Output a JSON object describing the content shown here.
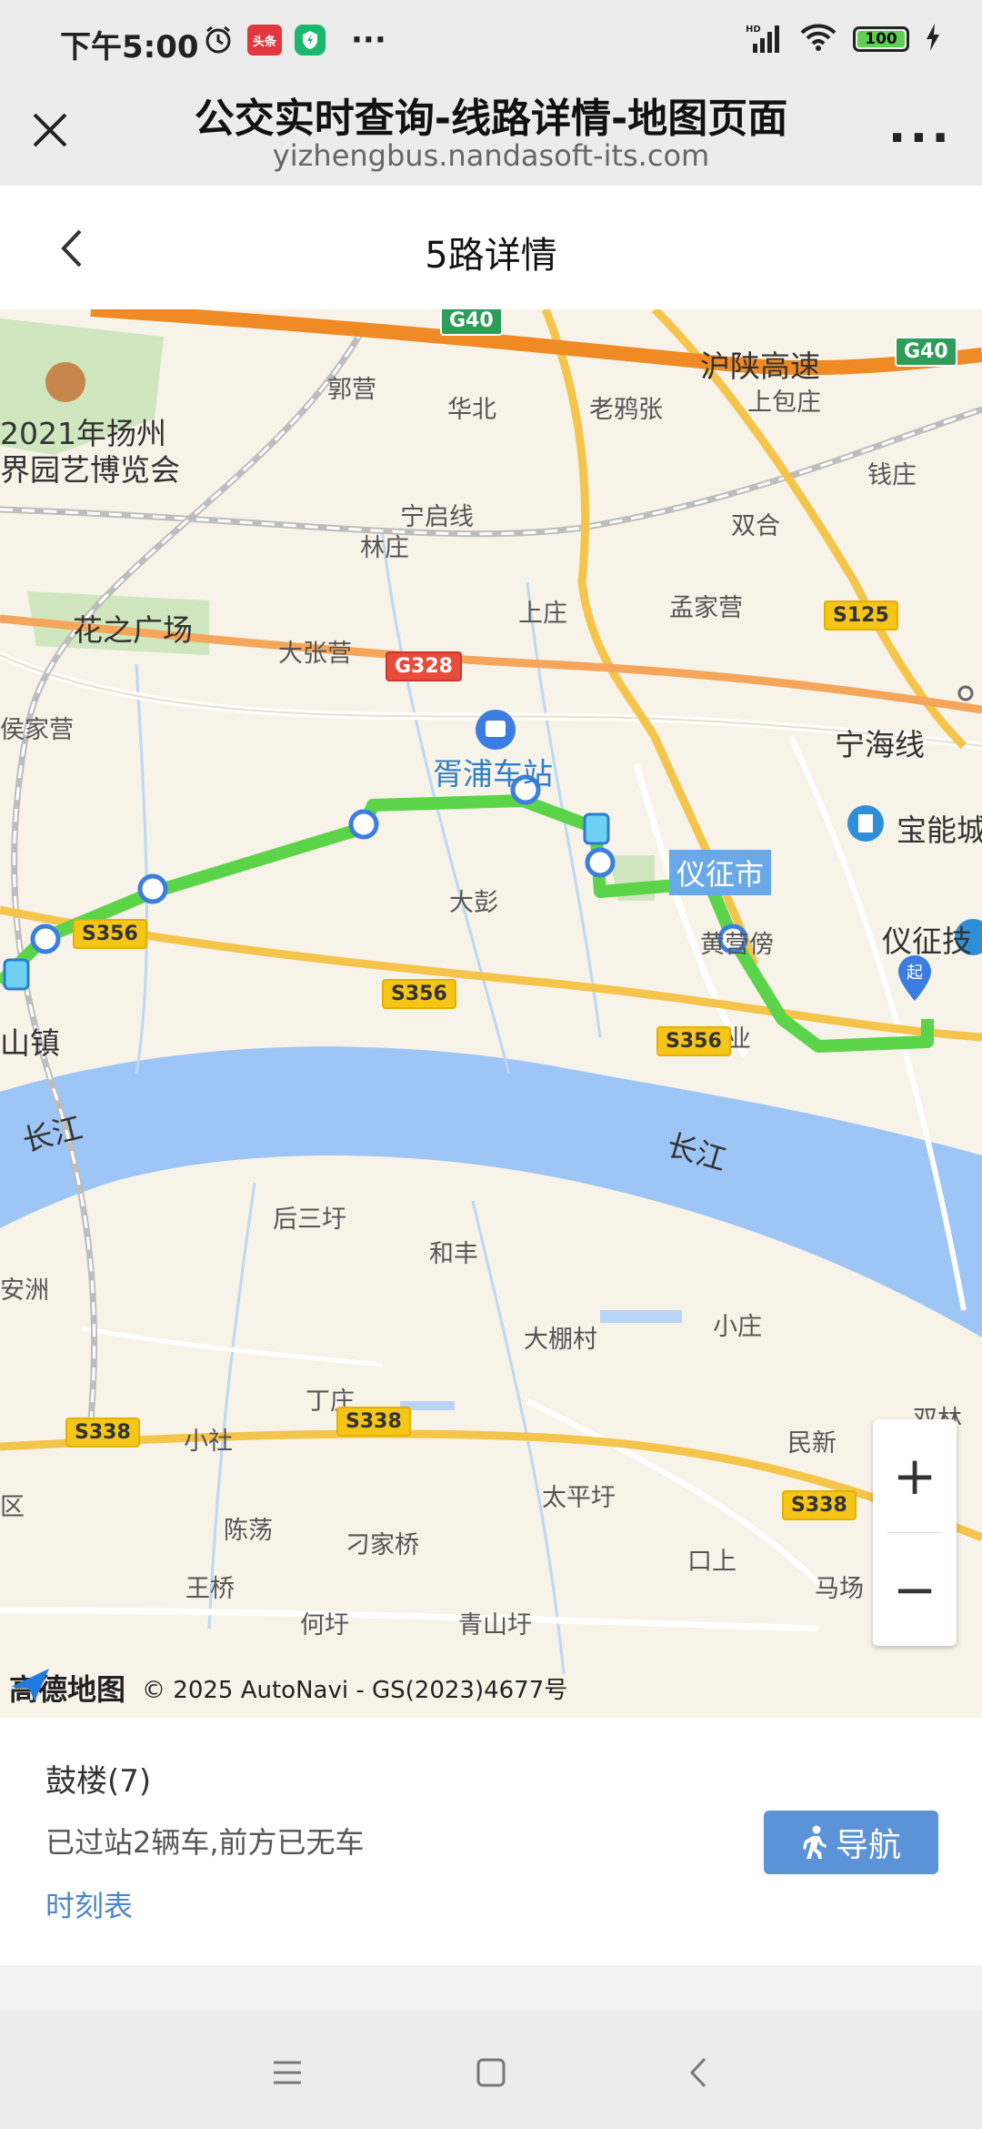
{
  "status_bar": {
    "time": "下午5:00",
    "news_badge": "头条",
    "battery": "100"
  },
  "browser": {
    "title": "公交实时查询-线路详情-地图页面",
    "url": "yizhengbus.nandasoft-its.com"
  },
  "page": {
    "title": "5路详情"
  },
  "map": {
    "place_labels": [
      {
        "text": "郭营",
        "cls": ""
      },
      {
        "text": "华北",
        "cls": ""
      },
      {
        "text": "老鸦张",
        "cls": ""
      },
      {
        "text": "上包庄",
        "cls": ""
      },
      {
        "text": "钱庄",
        "cls": ""
      },
      {
        "text": "2021年扬州",
        "cls": "big"
      },
      {
        "text": "界园艺博览会",
        "cls": "big"
      },
      {
        "text": "宁启线",
        "cls": ""
      },
      {
        "text": "林庄",
        "cls": ""
      },
      {
        "text": "双合",
        "cls": ""
      },
      {
        "text": "花之广场",
        "cls": "big"
      },
      {
        "text": "上庄",
        "cls": ""
      },
      {
        "text": "孟家营",
        "cls": ""
      },
      {
        "text": "大张营",
        "cls": ""
      },
      {
        "text": "侯家营",
        "cls": ""
      },
      {
        "text": "宁海线",
        "cls": "big"
      },
      {
        "text": "胥浦车站",
        "cls": "big blue"
      },
      {
        "text": "宝能城",
        "cls": "big"
      },
      {
        "text": "大彭",
        "cls": ""
      },
      {
        "text": "黄营傍",
        "cls": ""
      },
      {
        "text": "仪征技",
        "cls": "big"
      },
      {
        "text": "山镇",
        "cls": "big"
      },
      {
        "text": "林业",
        "cls": ""
      },
      {
        "text": "长江",
        "cls": "big"
      },
      {
        "text": "长江",
        "cls": "big"
      },
      {
        "text": "后三圩",
        "cls": ""
      },
      {
        "text": "和丰",
        "cls": ""
      },
      {
        "text": "安洲",
        "cls": ""
      },
      {
        "text": "大棚村",
        "cls": ""
      },
      {
        "text": "小庄",
        "cls": ""
      },
      {
        "text": "丁庄",
        "cls": ""
      },
      {
        "text": "双林",
        "cls": ""
      },
      {
        "text": "小社",
        "cls": ""
      },
      {
        "text": "民新",
        "cls": ""
      },
      {
        "text": "太平圩",
        "cls": ""
      },
      {
        "text": "区",
        "cls": ""
      },
      {
        "text": "陈荡",
        "cls": ""
      },
      {
        "text": "刁家桥",
        "cls": ""
      },
      {
        "text": "口上",
        "cls": ""
      },
      {
        "text": "王桥",
        "cls": ""
      },
      {
        "text": "马场",
        "cls": ""
      },
      {
        "text": "何圩",
        "cls": ""
      },
      {
        "text": "青山圩",
        "cls": ""
      },
      {
        "text": "沪陕高速",
        "cls": "big"
      }
    ],
    "road_badges": [
      {
        "text": "G40",
        "cls": "green"
      },
      {
        "text": "G40",
        "cls": "green"
      },
      {
        "text": "G328",
        "cls": "red"
      },
      {
        "text": "S125",
        "cls": "yellow"
      },
      {
        "text": "S356",
        "cls": "yellow"
      },
      {
        "text": "S356",
        "cls": "yellow"
      },
      {
        "text": "S356",
        "cls": "yellow"
      },
      {
        "text": "S338",
        "cls": "yellow"
      },
      {
        "text": "S338",
        "cls": "yellow"
      },
      {
        "text": "S338",
        "cls": "yellow"
      }
    ],
    "city_tag": "仪征市",
    "start_marker": "起",
    "zoom_in": "+",
    "zoom_out": "−",
    "logo_text": "高德地图",
    "copyright": "© 2025 AutoNavi - GS(2023)4677号"
  },
  "info": {
    "station": "鼓楼(7)",
    "status": "已过站2辆车,前方已无车",
    "timetable": "时刻表",
    "navigate": "导航"
  }
}
